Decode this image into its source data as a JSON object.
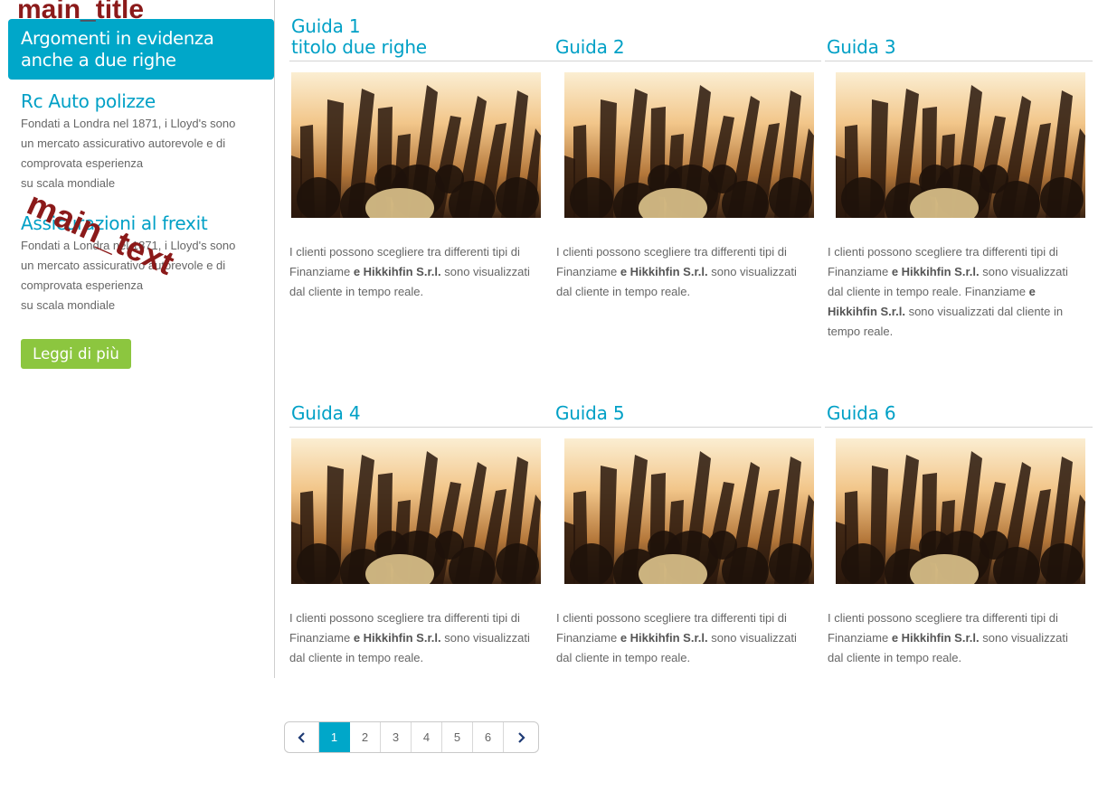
{
  "sidebar": {
    "main_title_tag": "main_title",
    "featured_box": {
      "line1": "Argomenti in evidenza",
      "line2": "anche a due righe"
    },
    "sections": [
      {
        "title": "Rc Auto polizze",
        "lines": [
          "Fondati a Londra nel 1871, i Lloyd's sono",
          "un mercato assicurativo autorevole e di",
          "comprovata esperienza",
          "su scala mondiale"
        ]
      },
      {
        "title": "Assicurazioni al frexit",
        "lines": [
          "Fondati a Londra nel 1871, i Lloyd's sono",
          "un mercato assicurativo autorevole e di",
          "comprovata esperienza",
          "su scala mondiale"
        ]
      }
    ],
    "main_text_tag": "main_text",
    "read_more_label": "Leggi di più"
  },
  "cards": [
    {
      "title": "Guida 1\ntitolo due righe",
      "text_lines": [
        [
          "I clienti possono scegliere tra differenti tipi di",
          ""
        ],
        [
          "Finanziame ",
          "e Hikkihfin S.r.l.",
          " sono visualizzati"
        ],
        [
          "dal cliente in  tempo reale.",
          ""
        ]
      ]
    },
    {
      "title": "Guida 2",
      "text_lines": [
        [
          "I clienti possono scegliere tra differenti tipi di",
          ""
        ],
        [
          "Finanziame ",
          "e Hikkihfin S.r.l.",
          " sono visualizzati"
        ],
        [
          "dal cliente in  tempo reale.",
          ""
        ]
      ]
    },
    {
      "title": "Guida 3",
      "text_lines": [
        [
          "I clienti possono scegliere tra differenti tipi di",
          ""
        ],
        [
          "Finanziame ",
          "e Hikkihfin S.r.l.",
          " sono visualizzati"
        ],
        [
          "dal cliente in  tempo reale. Finanziame ",
          "e",
          ""
        ],
        [
          "",
          "Hikkihfin S.r.l.",
          " sono visualizzati dal cliente in"
        ],
        [
          "tempo reale.",
          ""
        ]
      ]
    },
    {
      "title": "Guida 4",
      "text_lines": [
        [
          "I clienti possono scegliere tra differenti tipi di",
          ""
        ],
        [
          "Finanziame ",
          "e Hikkihfin S.r.l.",
          " sono visualizzati"
        ],
        [
          "dal cliente in  tempo reale.",
          ""
        ]
      ]
    },
    {
      "title": "Guida 5",
      "text_lines": [
        [
          "I clienti possono scegliere tra differenti tipi di",
          ""
        ],
        [
          "Finanziame ",
          "e Hikkihfin S.r.l.",
          " sono visualizzati"
        ],
        [
          "dal cliente in  tempo reale.",
          ""
        ]
      ]
    },
    {
      "title": "Guida 6",
      "text_lines": [
        [
          "I clienti possono scegliere tra differenti tipi di",
          ""
        ],
        [
          "Finanziame ",
          "e Hikkihfin S.r.l.",
          " sono visualizzati"
        ],
        [
          "dal cliente in  tempo reale.",
          ""
        ]
      ]
    }
  ],
  "pagination": {
    "prev_icon": "chevron-left-icon",
    "next_icon": "chevron-right-icon",
    "pages": [
      "1",
      "2",
      "3",
      "4",
      "5",
      "6"
    ],
    "active": "1"
  },
  "colors": {
    "accent": "#00a7c9",
    "heading": "#00a0c6",
    "button": "#8cc63f",
    "tag": "#8b1a1a"
  }
}
